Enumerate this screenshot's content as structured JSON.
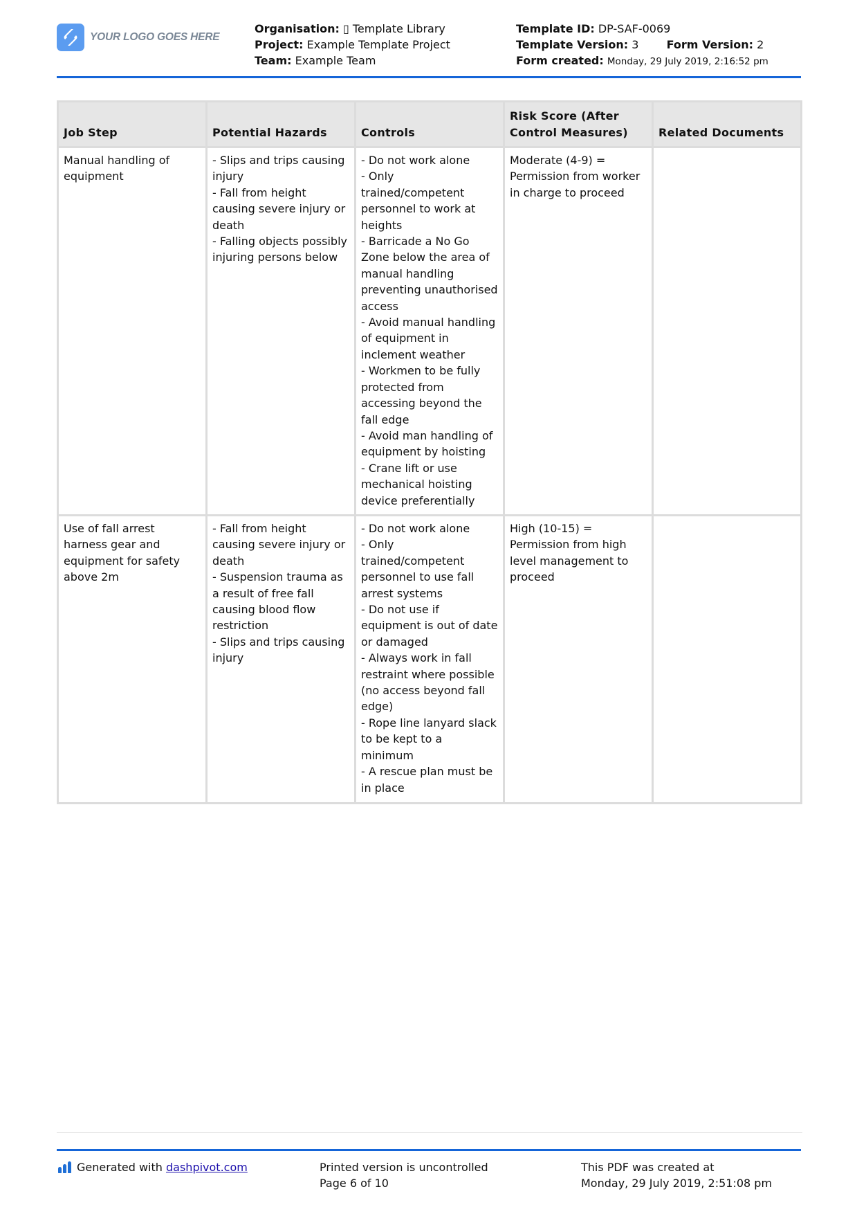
{
  "header": {
    "logo_text": "YOUR LOGO GOES HERE",
    "organisation_label": "Organisation:",
    "organisation_value": "▯ Template Library",
    "project_label": "Project:",
    "project_value": "Example Template Project",
    "team_label": "Team:",
    "team_value": "Example Team",
    "template_id_label": "Template ID:",
    "template_id_value": "DP-SAF-0069",
    "template_version_label": "Template Version:",
    "template_version_value": "3",
    "form_version_label": "Form Version:",
    "form_version_value": "2",
    "form_created_label": "Form created:",
    "form_created_value": "Monday, 29 July 2019, 2:16:52 pm"
  },
  "table": {
    "columns": [
      "Job Step",
      "Potential Hazards",
      "Controls",
      "Risk Score (After Control Measures)",
      "Related Documents"
    ],
    "rows": [
      {
        "job_step": [
          "Manual handling of equipment"
        ],
        "hazards": [
          "- Slips and trips causing injury",
          "- Fall from height causing severe injury or death",
          "- Falling objects possibly injuring persons below"
        ],
        "controls": [
          "- Do not work alone",
          "- Only trained/competent personnel to work at heights",
          "- Barricade a No Go Zone below the area of manual handling preventing unauthorised access",
          "- Avoid manual handling of equipment in inclement weather",
          "- Workmen to be fully protected from accessing beyond the fall edge",
          "- Avoid man handling of equipment by hoisting",
          "- Crane lift or use mechanical hoisting device preferentially"
        ],
        "risk_score": [
          "Moderate (4-9) = Permission from worker in charge to proceed"
        ],
        "related_documents": ""
      },
      {
        "job_step": [
          "Use of fall arrest harness gear and equipment for safety above 2m"
        ],
        "hazards": [
          "- Fall from height causing severe injury or death",
          "- Suspension trauma as a result of free fall causing blood flow restriction",
          "- Slips and trips causing injury"
        ],
        "controls": [
          "- Do not work alone",
          "- Only trained/competent personnel to use fall arrest systems",
          "- Do not use if equipment is out of date or damaged",
          "- Always work in fall restraint where possible (no access beyond fall edge)",
          "- Rope line lanyard slack to be kept to a minimum",
          "- A rescue plan must be in place"
        ],
        "risk_score": [
          "High (10-15) = Permission from high level management to proceed"
        ],
        "related_documents": ""
      }
    ]
  },
  "footer": {
    "generated_prefix": "Generated with ",
    "generated_link": "dashpivot.com",
    "uncontrolled": "Printed version is uncontrolled",
    "page": "Page 6 of 10",
    "pdf_created_label": "This PDF was created at",
    "pdf_created_value": "Monday, 29 July 2019, 2:51:08 pm"
  },
  "colors": {
    "accent_rule": "#1565d8",
    "logo_blue": "#5b9cf0",
    "header_bg": "#e6e6e6",
    "border": "#dcdcdc",
    "link": "#1a0dab"
  }
}
